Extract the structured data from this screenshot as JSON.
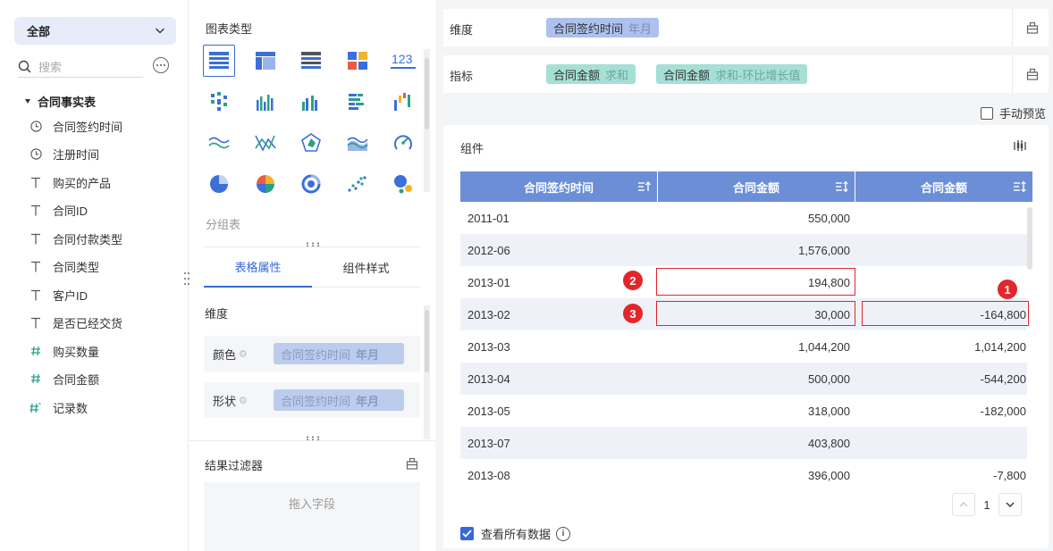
{
  "left": {
    "select_value": "全部",
    "search_placeholder": "搜索",
    "table_name": "合同事实表",
    "fields": [
      {
        "name": "合同签约时间",
        "icon": "clock-icon"
      },
      {
        "name": "注册时间",
        "icon": "clock-icon"
      },
      {
        "name": "购买的产品",
        "icon": "text-type-icon"
      },
      {
        "name": "合同ID",
        "icon": "text-type-icon"
      },
      {
        "name": "合同付款类型",
        "icon": "text-type-icon"
      },
      {
        "name": "合同类型",
        "icon": "text-type-icon"
      },
      {
        "name": "客户ID",
        "icon": "text-type-icon"
      },
      {
        "name": "是否已经交货",
        "icon": "text-type-icon"
      },
      {
        "name": "购买数量",
        "icon": "number-type-icon"
      },
      {
        "name": "合同金额",
        "icon": "number-type-icon"
      },
      {
        "name": "记录数",
        "icon": "record-count-icon"
      }
    ]
  },
  "middle": {
    "chart_types_title": "图表类型",
    "number_chart_label": "123",
    "group_table_label": "分组表",
    "tabs": [
      "表格属性",
      "组件样式"
    ],
    "dimension_label": "维度",
    "props": [
      {
        "label": "颜色",
        "field": "合同签约时间",
        "granularity": "年月"
      },
      {
        "label": "形状",
        "field": "合同签约时间",
        "granularity": "年月"
      }
    ],
    "filter_title": "结果过滤器",
    "filter_placeholder": "拖入字段"
  },
  "right": {
    "dimension_label": "维度",
    "dimension_pill": {
      "field": "合同签约时间",
      "sub": "年月"
    },
    "metric_label": "指标",
    "metric_pills": [
      {
        "field": "合同金额",
        "sub": "求和"
      },
      {
        "field": "合同金额",
        "sub": "求和-环比增长值"
      }
    ],
    "manual_preview": "手动预览",
    "component_title": "组件",
    "table": {
      "headers": [
        "合同签约时间",
        "合同金额",
        "合同金额"
      ],
      "rows": [
        [
          "2011-01",
          "550,000",
          ""
        ],
        [
          "2012-06",
          "1,576,000",
          ""
        ],
        [
          "2013-01",
          "194,800",
          ""
        ],
        [
          "2013-02",
          "30,000",
          "-164,800"
        ],
        [
          "2013-03",
          "1,044,200",
          "1,014,200"
        ],
        [
          "2013-04",
          "500,000",
          "-544,200"
        ],
        [
          "2013-05",
          "318,000",
          "-182,000"
        ],
        [
          "2013-07",
          "403,800",
          ""
        ],
        [
          "2013-08",
          "396,000",
          "-7,800"
        ]
      ]
    },
    "badges": [
      "1",
      "2",
      "3"
    ],
    "page_number": "1",
    "view_all_label": "查看所有数据",
    "colors": {
      "accent": "#3769d8",
      "header": "#6b8ed6",
      "highlight": "#e2262c"
    }
  }
}
